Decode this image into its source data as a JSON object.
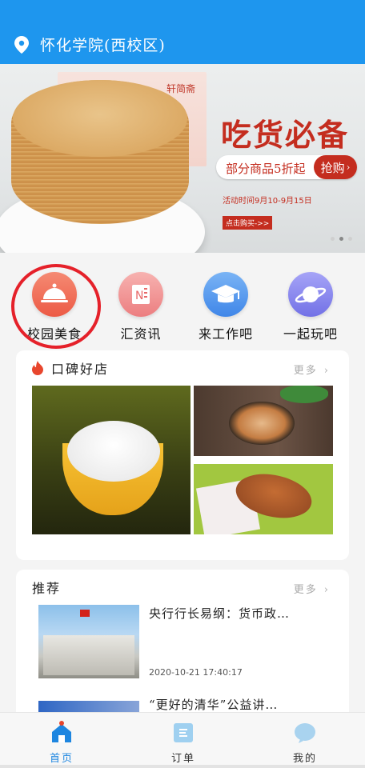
{
  "header": {
    "location": "怀化学院(西校区)",
    "icon": "location-pin-icon",
    "bg_color": "#1e96ee"
  },
  "banner": {
    "box_label": "轩简斋",
    "headline": "吃货必备",
    "promo_text": "部分商品5折起",
    "promo_button": "抢购",
    "time_text": "活动时间9月10-9月15日",
    "buy_text": "点击购买->>",
    "accent_color": "#c42d1f"
  },
  "categories": [
    {
      "label": "校园美食",
      "icon": "food-cloche-icon"
    },
    {
      "label": "汇资讯",
      "icon": "onenote-icon"
    },
    {
      "label": "来工作吧",
      "icon": "graduation-cap-icon"
    },
    {
      "label": "一起玩吧",
      "icon": "planet-icon"
    }
  ],
  "popular": {
    "title": "口碑好店",
    "more": "更多",
    "icon": "flame-icon"
  },
  "recommend": {
    "title": "推荐",
    "more": "更多",
    "items": [
      {
        "headline": "央行行长易纲：货币政…",
        "date": "2020-10-21 17:40:17"
      },
      {
        "headline": "“更好的清华”公益讲…"
      }
    ]
  },
  "tabs": [
    {
      "label": "首页",
      "icon": "home-icon",
      "active": true
    },
    {
      "label": "订单",
      "icon": "order-icon",
      "active": false
    },
    {
      "label": "我的",
      "icon": "profile-bubble-icon",
      "active": false
    }
  ]
}
